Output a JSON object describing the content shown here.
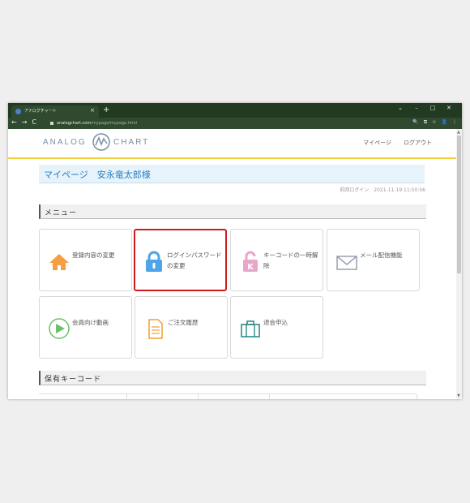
{
  "browser": {
    "tab_title": "アナログチャート",
    "tab_close": "×",
    "new_tab": "+",
    "window_controls": [
      "⌄",
      "–",
      "□",
      "✕"
    ],
    "nav_icons": [
      "←",
      "→",
      "C"
    ],
    "url_host": "analogchart.com",
    "url_path": "/mypage/mypage.html",
    "toolbar_icons": [
      "🔍",
      "⧉",
      "☆",
      "👤",
      "⋮"
    ]
  },
  "logo": {
    "left_text": "ANALOG",
    "right_text": "CHART",
    "accent": "#7a8fa5"
  },
  "header_nav": {
    "mypage": "マイページ",
    "logout": "ログアウト"
  },
  "title": "マイページ　安永竜太郎様",
  "last_login": "前回ログイン　2021-11-19 11:50:56",
  "menu_heading": "メニュー",
  "menu_items": [
    {
      "label": "登録内容の変更",
      "icon": "house-icon",
      "color": "#f4a040"
    },
    {
      "label": "ログインパスワードの変更",
      "icon": "lock-icon",
      "color": "#4ea4e6"
    },
    {
      "label": "キーコードの一時解除",
      "icon": "keylock-icon",
      "color": "#e8a6c8"
    },
    {
      "label": "メール配信機能",
      "icon": "mail-icon",
      "color": "#8a90a6"
    },
    {
      "label": "会員向け動画",
      "icon": "play-icon",
      "color": "#6cc06c"
    },
    {
      "label": "ご注文履歴",
      "icon": "document-icon",
      "color": "#f0a030"
    },
    {
      "label": "退会申込",
      "icon": "briefcase-icon",
      "color": "#2f8a8a"
    }
  ],
  "keycode_heading": "保有キーコード",
  "highlight_color": "#cf1b1b"
}
